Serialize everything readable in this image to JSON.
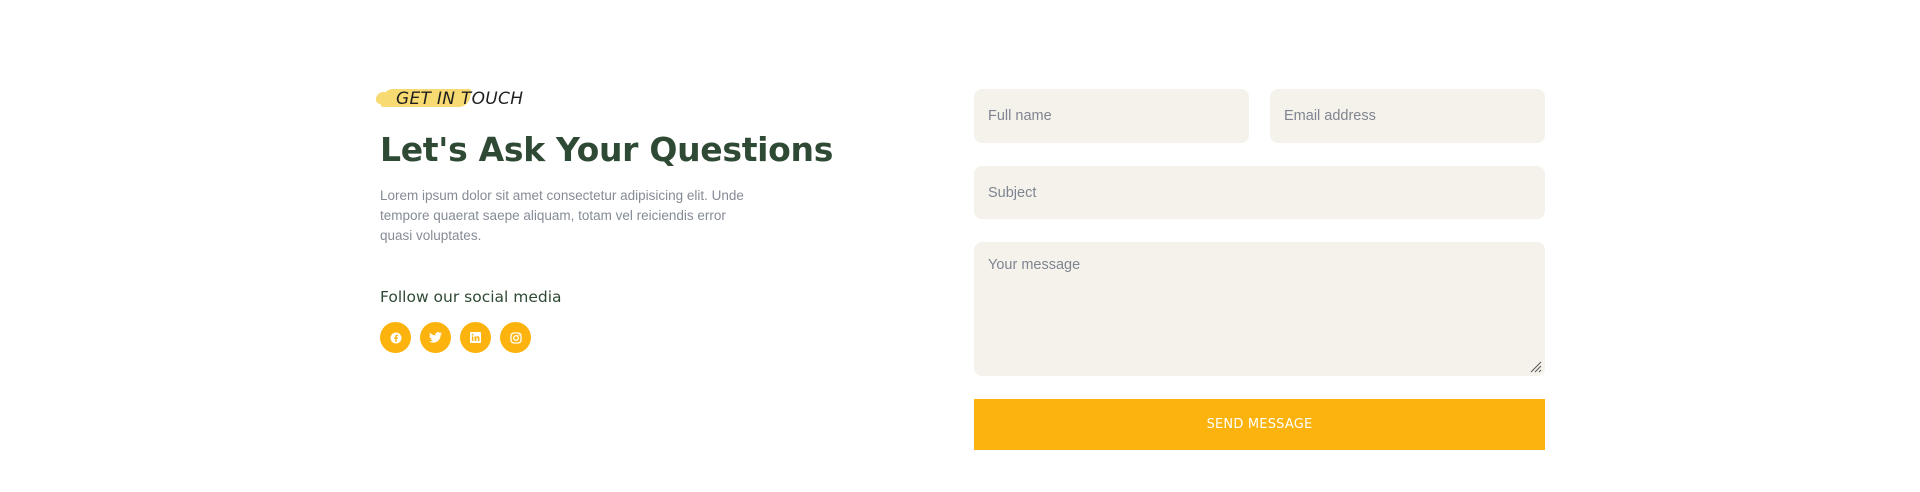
{
  "contact": {
    "eyebrow": "GET IN TOUCH",
    "headline": "Let's Ask Your Questions",
    "lead": "Lorem ipsum dolor sit amet consectetur adipisicing elit. Unde tempore quaerat saepe aliquam, totam vel reiciendis error quasi voluptates.",
    "follow_title": "Follow our social media",
    "socials": [
      {
        "icon": "facebook-icon"
      },
      {
        "icon": "twitter-icon"
      },
      {
        "icon": "linkedin-icon"
      },
      {
        "icon": "instagram-icon"
      }
    ]
  },
  "form": {
    "full_name": {
      "placeholder": "Full name",
      "value": ""
    },
    "email": {
      "placeholder": "Email address",
      "value": ""
    },
    "subject": {
      "placeholder": "Subject",
      "value": ""
    },
    "message": {
      "placeholder": "Your message",
      "value": ""
    },
    "submit_label": "SEND MESSAGE"
  },
  "colors": {
    "accent": "#fdb30e",
    "heading": "#2f4a34",
    "body_text": "#858b96",
    "field_bg": "#f5f2ec",
    "highlight": "#f7d96a"
  }
}
